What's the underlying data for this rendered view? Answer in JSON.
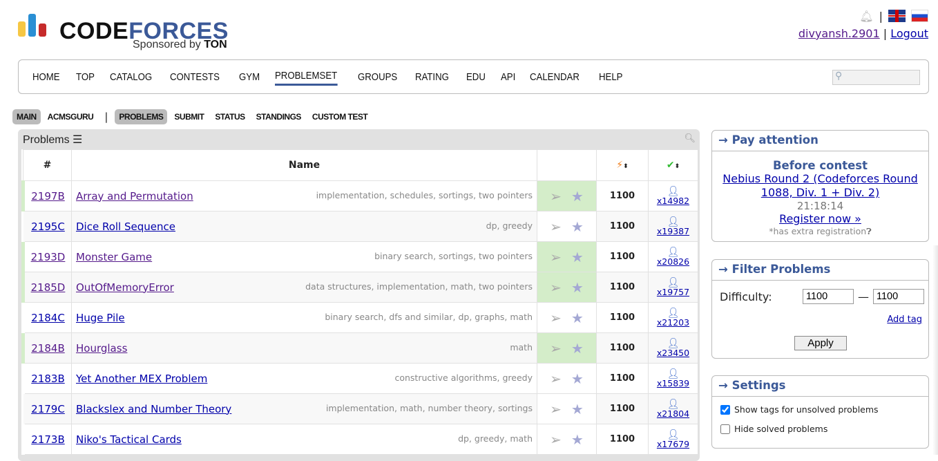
{
  "header": {
    "brand_part1": "CODE",
    "brand_part2": "FORCES",
    "sponsor_prefix": "Sponsored by",
    "sponsor_name": "TON",
    "username": "divyansh.2901",
    "logout": "Logout",
    "separator": "|"
  },
  "nav": [
    "HOME",
    "TOP",
    "CATALOG",
    "CONTESTS",
    "GYM",
    "PROBLEMSET",
    "GROUPS",
    "RATING",
    "EDU",
    "API",
    "CALENDAR",
    "HELP"
  ],
  "nav_active": "PROBLEMSET",
  "subnav": {
    "left": [
      "MAIN",
      "ACMSGURU"
    ],
    "right": [
      "PROBLEMS",
      "SUBMIT",
      "STATUS",
      "STANDINGS",
      "CUSTOM TEST"
    ]
  },
  "problems": {
    "title": "Problems",
    "col_id": "#",
    "col_name": "Name",
    "rows": [
      {
        "id": "2197B",
        "name": "Array and Permutation",
        "tags": "implementation, schedules, sortings, two pointers",
        "rating": "1100",
        "solved": "x14982",
        "accepted": true
      },
      {
        "id": "2195C",
        "name": "Dice Roll Sequence",
        "tags": "dp, greedy",
        "rating": "1100",
        "solved": "x19387",
        "accepted": false
      },
      {
        "id": "2193D",
        "name": "Monster Game",
        "tags": "binary search, sortings, two pointers",
        "rating": "1100",
        "solved": "x20826",
        "accepted": true
      },
      {
        "id": "2185D",
        "name": "OutOfMemoryError",
        "tags": "data structures, implementation, math, two pointers",
        "rating": "1100",
        "solved": "x19757",
        "accepted": true
      },
      {
        "id": "2184C",
        "name": "Huge Pile",
        "tags": "binary search, dfs and similar, dp, graphs, math",
        "rating": "1100",
        "solved": "x21203",
        "accepted": false
      },
      {
        "id": "2184B",
        "name": "Hourglass",
        "tags": "math",
        "rating": "1100",
        "solved": "x23450",
        "accepted": true
      },
      {
        "id": "2183B",
        "name": "Yet Another MEX Problem",
        "tags": "constructive algorithms, greedy",
        "rating": "1100",
        "solved": "x15839",
        "accepted": false
      },
      {
        "id": "2179C",
        "name": "Blackslex and Number Theory",
        "tags": "implementation, math, number theory, sortings",
        "rating": "1100",
        "solved": "x21804",
        "accepted": false
      },
      {
        "id": "2173B",
        "name": "Niko's Tactical Cards",
        "tags": "dp, greedy, math",
        "rating": "1100",
        "solved": "x17679",
        "accepted": false
      }
    ]
  },
  "pay_attention": {
    "title": "→ Pay attention",
    "subtitle": "Before contest",
    "contest": "Nebius Round 2 (Codeforces Round 1088, Div. 1 + Div. 2)",
    "countdown": "21:18:14",
    "register": "Register now »",
    "extra": "*has extra registration"
  },
  "filter": {
    "title": "→ Filter Problems",
    "label": "Difficulty:",
    "min": "1100",
    "dash": "—",
    "max": "1100",
    "add_tag": "Add tag",
    "apply": "Apply"
  },
  "settings": {
    "title": "→ Settings",
    "show_tags": "Show tags for unsolved problems",
    "show_tags_checked": true,
    "hide_solved": "Hide solved problems",
    "hide_solved_checked": false
  },
  "colors": {
    "accent": "#3b5998",
    "accepted": "#d4edc9"
  }
}
